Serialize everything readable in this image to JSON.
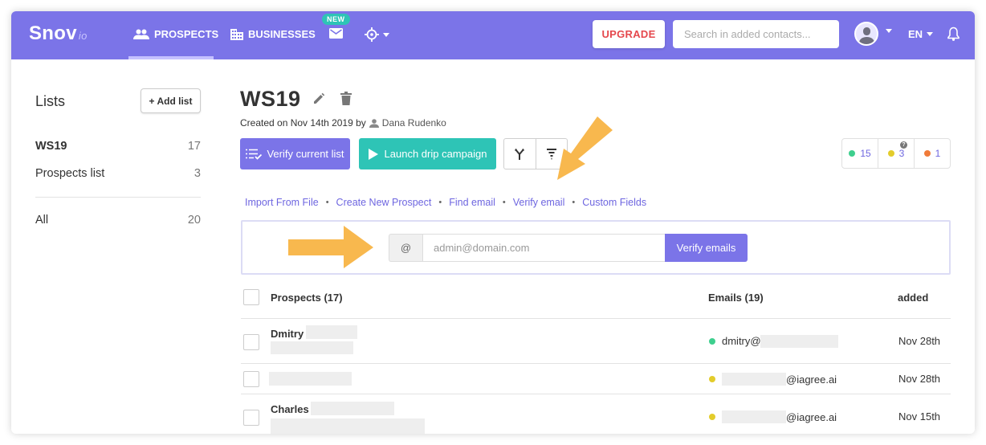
{
  "nav": {
    "logo_main": "Snov",
    "logo_suffix": "io",
    "prospects_label": "PROSPECTS",
    "businesses_label": "BUSINESSES",
    "new_badge": "NEW",
    "upgrade_label": "UPGRADE",
    "search_placeholder": "Search in added contacts...",
    "language": "EN"
  },
  "sidebar": {
    "title": "Lists",
    "add_list_label": "+ Add list",
    "lists": [
      {
        "name": "WS19",
        "count": "17"
      },
      {
        "name": "Prospects list",
        "count": "3"
      }
    ],
    "all": {
      "name": "All",
      "count": "20"
    }
  },
  "list_header": {
    "name": "WS19",
    "created_text": "Created on Nov 14th 2019 by",
    "author": "Dana Rudenko",
    "verify_current_list_label": "Verify current list",
    "launch_drip_label": "Launch drip campaign"
  },
  "status_counts": {
    "green": "15",
    "yellow": "3",
    "orange": "1",
    "colors": {
      "green": "#3ecf8e",
      "yellow": "#e3cc2b",
      "orange": "#f07b39"
    }
  },
  "actions": {
    "import": "Import From File",
    "create": "Create New Prospect",
    "find": "Find email",
    "verify": "Verify email",
    "custom": "Custom Fields"
  },
  "verify_panel": {
    "at": "@",
    "placeholder": "admin@domain.com",
    "button_label": "Verify emails"
  },
  "table": {
    "col_prospects": "Prospects (17)",
    "col_emails": "Emails (19)",
    "col_added": "added",
    "rows": [
      {
        "name": "Dmitry",
        "email": "dmitry@",
        "status": "green",
        "added": "Nov 28th"
      },
      {
        "name": "",
        "email": "@iagree.ai",
        "status": "yellow",
        "added": "Nov 28th"
      },
      {
        "name": "Charles",
        "email": "@iagree.ai",
        "status": "yellow",
        "added": "Nov 15th"
      }
    ]
  },
  "colors": {
    "accent": "#7b74e8",
    "teal": "#2ec4b6",
    "annotation_arrow": "#f8b84e",
    "upgrade_red": "#e5484d"
  }
}
